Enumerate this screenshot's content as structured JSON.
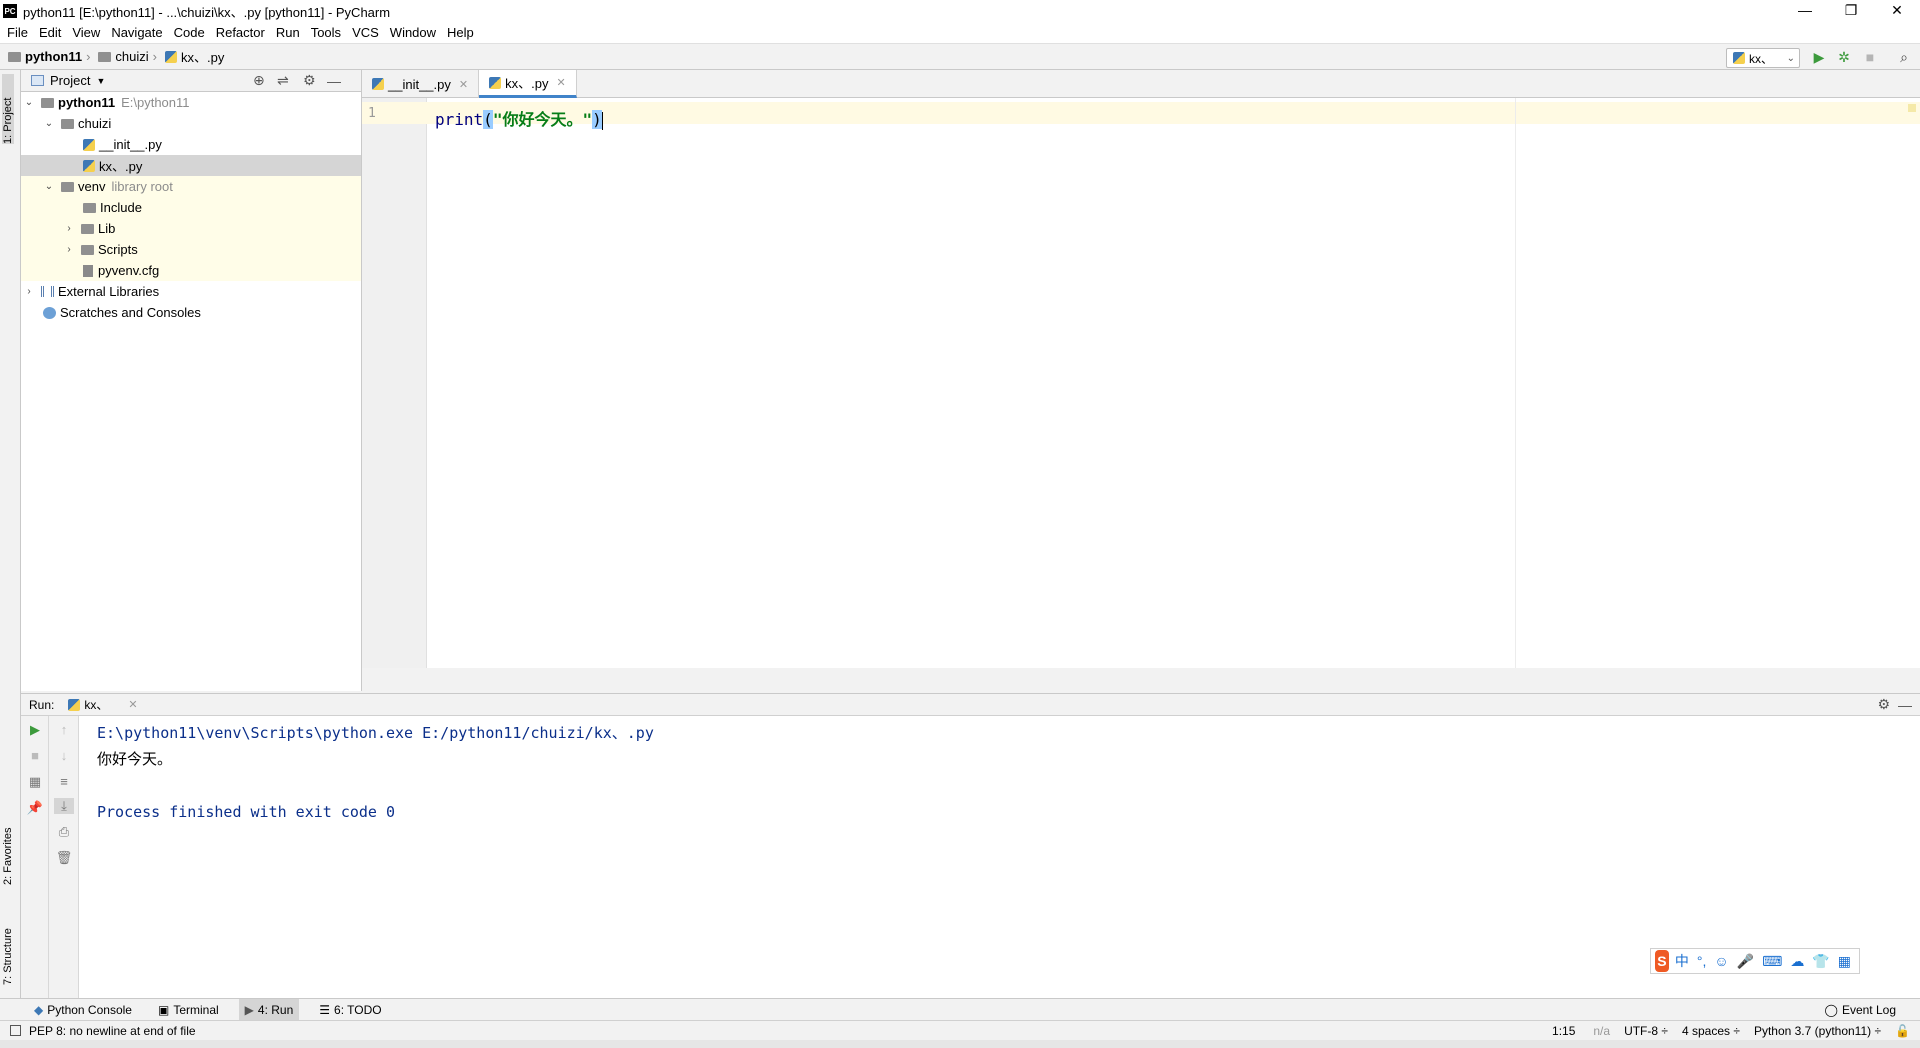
{
  "window": {
    "title": "python11 [E:\\python11] - ...\\chuizi\\kx、.py [python11] - PyCharm",
    "minimize": "—",
    "maximize": "❐",
    "close": "✕"
  },
  "menu": [
    "File",
    "Edit",
    "View",
    "Navigate",
    "Code",
    "Refactor",
    "Run",
    "Tools",
    "VCS",
    "Window",
    "Help"
  ],
  "breadcrumb": {
    "project": "python11",
    "folder": "chuizi",
    "file": "kx、.py"
  },
  "toolbar": {
    "run_config": "kx、"
  },
  "left_stripe": {
    "project_tab": "1: Project",
    "favorites_tab": "2: Favorites",
    "structure_tab": "7: Structure"
  },
  "project_panel": {
    "title": "Project",
    "tree": {
      "root_name": "python11",
      "root_path": "E:\\python11",
      "chuizi": "chuizi",
      "init_file": "__init__.py",
      "kx_file": "kx、.py",
      "venv": "venv",
      "venv_hint": "library root",
      "include": "Include",
      "lib": "Lib",
      "scripts": "Scripts",
      "cfg": "pyvenv.cfg",
      "ext_libs": "External Libraries",
      "scratches": "Scratches and Consoles"
    }
  },
  "editor": {
    "tabs": [
      "__init__.py",
      "kx、.py"
    ],
    "line_number": "1",
    "code": {
      "func": "print",
      "open": "(",
      "string": "\"你好今天。\"",
      "close": ")"
    }
  },
  "run_panel": {
    "label": "Run:",
    "tab": "kx、",
    "lines": {
      "command": "E:\\python11\\venv\\Scripts\\python.exe E:/python11/chuizi/kx、.py",
      "output": "你好今天。",
      "exit": "Process finished with exit code 0"
    }
  },
  "ime": {
    "logo": "S",
    "items": [
      "中",
      "°,",
      "☺",
      "🎤",
      "⌨",
      "☁",
      "👕",
      "▦"
    ]
  },
  "bottom_tabs": {
    "python_console": "Python Console",
    "terminal": "Terminal",
    "run": "4: Run",
    "todo": "6: TODO",
    "event_log": "Event Log"
  },
  "status": {
    "message": "PEP 8: no newline at end of file",
    "position": "1:15",
    "na": "n/a",
    "encoding": "UTF-8 ÷",
    "indent": "4 spaces ÷",
    "interpreter": "Python 3.7 (python11) ÷"
  }
}
